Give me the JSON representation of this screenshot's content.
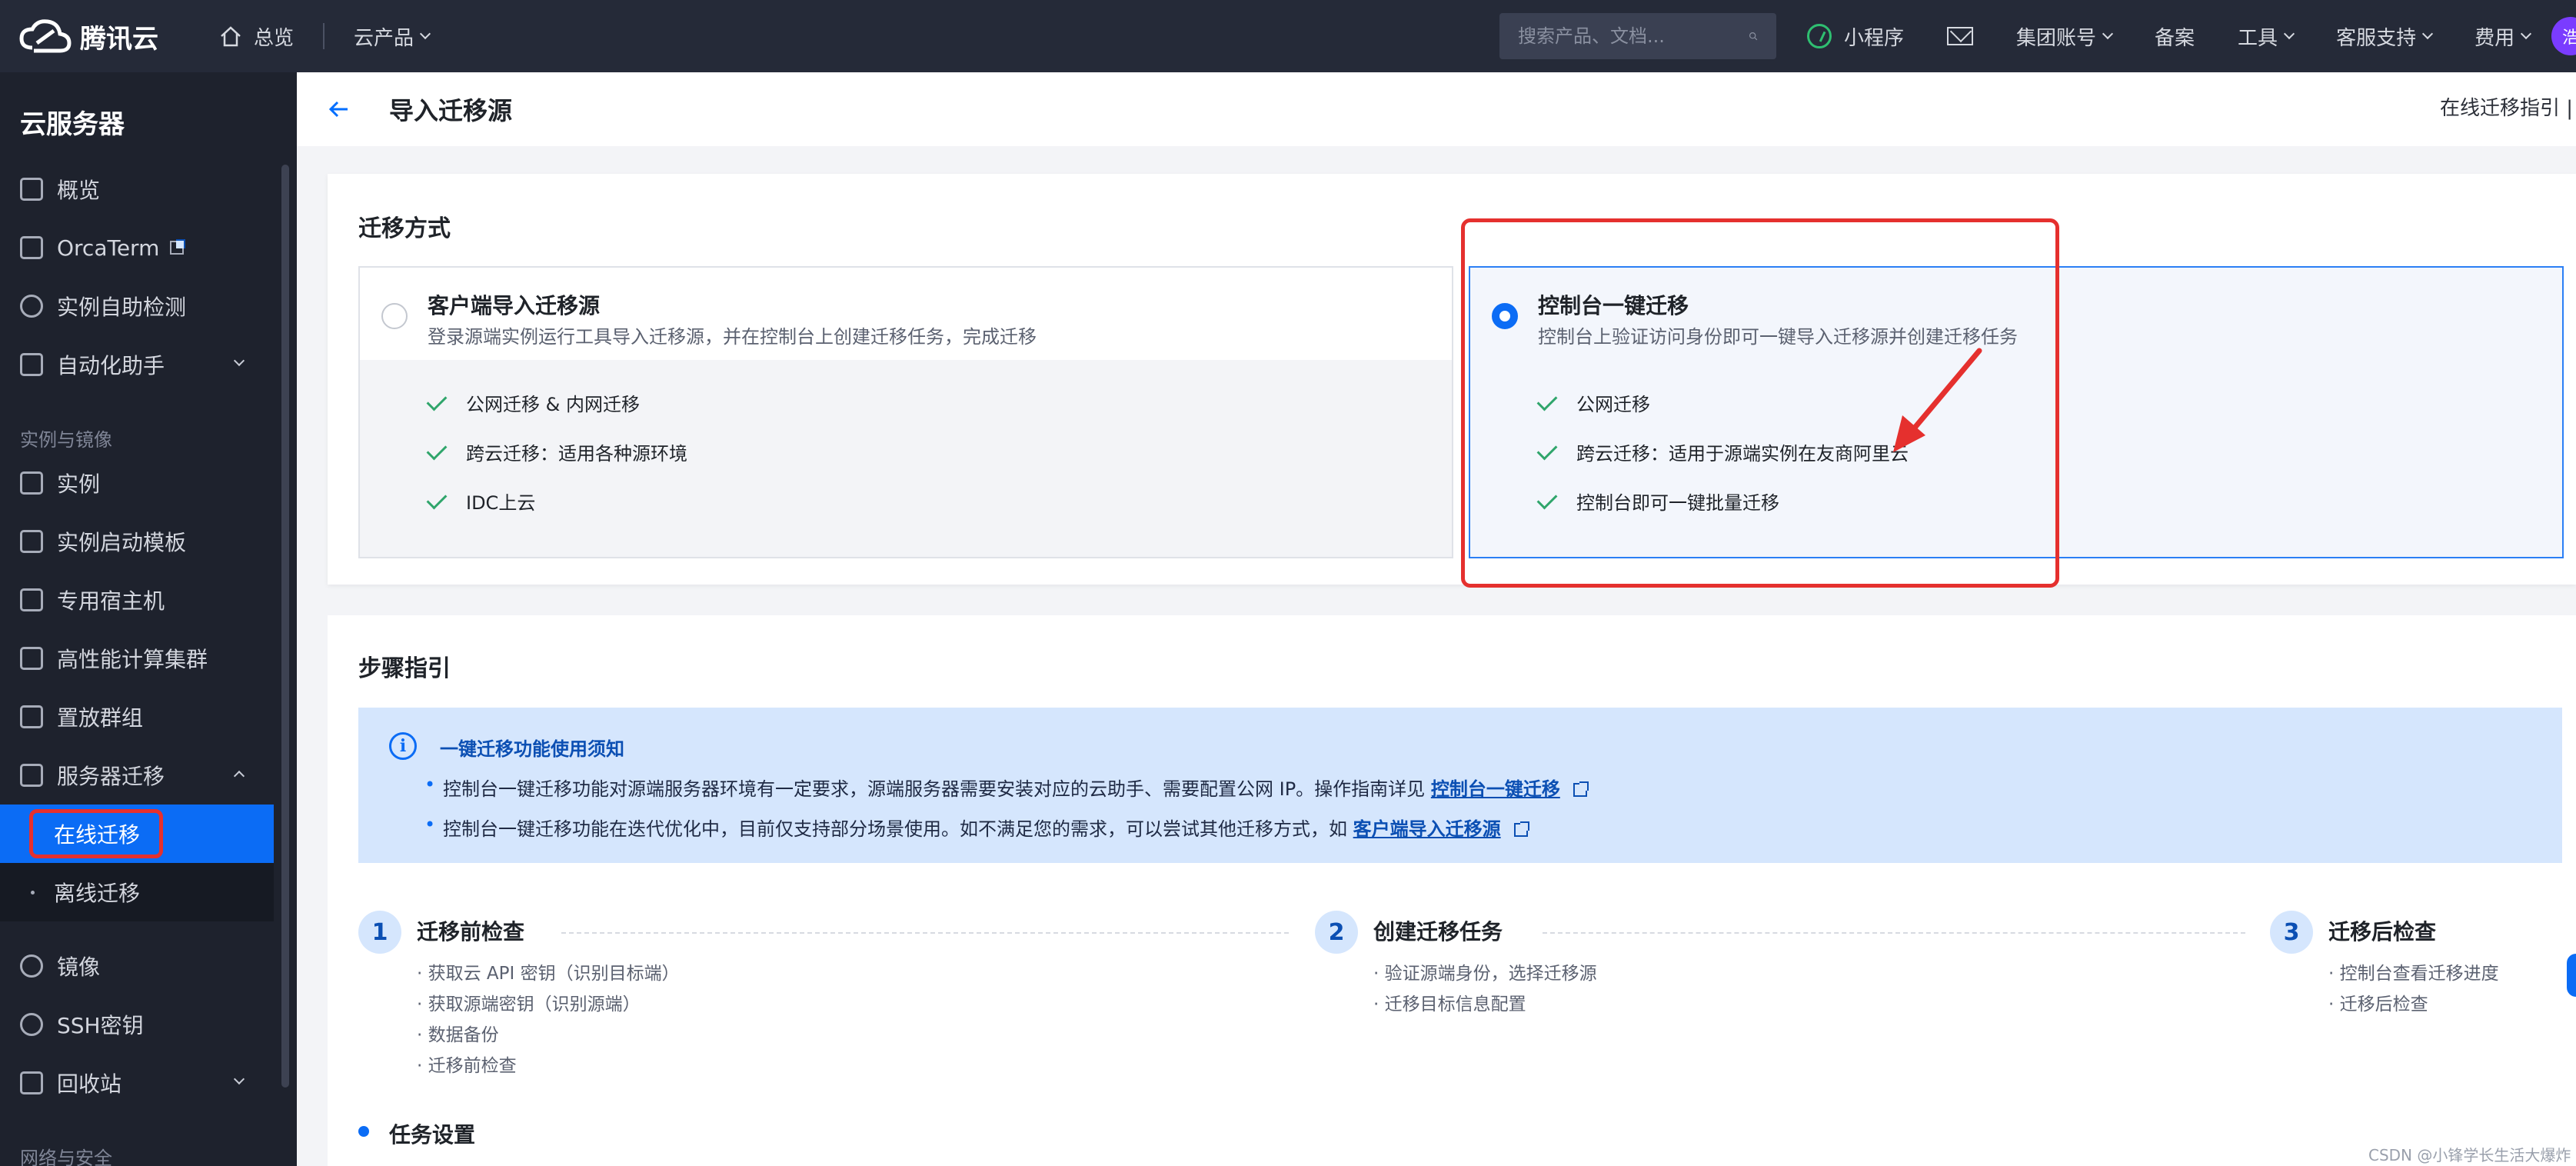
{
  "topbar": {
    "brand": "腾讯云",
    "home": "总览",
    "products": "云产品",
    "search_placeholder": "搜索产品、文档...",
    "items": [
      "小程序",
      "集团账号",
      "备案",
      "工具",
      "客服支持",
      "费用"
    ],
    "avatar": "浩"
  },
  "sidebar": {
    "title": "云服务器",
    "items": {
      "overview": "概览",
      "orcaterm": "OrcaTerm",
      "selfcheck": "实例自助检测",
      "automation": "自动化助手",
      "group1": "实例与镜像",
      "instances": "实例",
      "templates": "实例启动模板",
      "dedicated": "专用宿主机",
      "hpc": "高性能计算集群",
      "placement": "置放群组",
      "migration": "服务器迁移",
      "online": "在线迁移",
      "offline": "离线迁移",
      "images": "镜像",
      "ssh": "SSH密钥",
      "recycle": "回收站",
      "group2": "网络与安全"
    }
  },
  "header": {
    "title": "导入迁移源",
    "guide": "在线迁移指引 |"
  },
  "migration_method": {
    "section_title": "迁移方式",
    "options": [
      {
        "title": "客户端导入迁移源",
        "desc": "登录源端实例运行工具导入迁移源，并在控制台上创建迁移任务，完成迁移",
        "features": [
          "公网迁移 & 内网迁移",
          "跨云迁移：适用各种源环境",
          "IDC上云"
        ],
        "selected": false
      },
      {
        "title": "控制台一键迁移",
        "desc": "控制台上验证访问身份即可一键导入迁移源并创建迁移任务",
        "features": [
          "公网迁移",
          "跨云迁移：适用于源端实例在友商阿里云",
          "控制台即可一键批量迁移"
        ],
        "selected": true
      }
    ]
  },
  "steps_guide": {
    "section_title": "步骤指引",
    "notice": {
      "title": "一键迁移功能使用须知",
      "line1": "控制台一键迁移功能对源端服务器环境有一定要求，源端服务器需要安装对应的云助手、需要配置公网 IP。操作指南详见",
      "line1_link": "控制台一键迁移",
      "line2": "控制台一键迁移功能在迭代优化中，目前仅支持部分场景使用。如不满足您的需求，可以尝试其他迁移方式，如",
      "line2_link": "客户端导入迁移源"
    },
    "steps": [
      {
        "num": "1",
        "title": "迁移前检查",
        "items": [
          "· 获取云 API 密钥（识别目标端）",
          "· 获取源端密钥（识别源端）",
          "· 数据备份",
          "· 迁移前检查"
        ]
      },
      {
        "num": "2",
        "title": "创建迁移任务",
        "items": [
          "· 验证源端身份，选择迁移源",
          "· 迁移目标信息配置"
        ]
      },
      {
        "num": "3",
        "title": "迁移后检查",
        "items": [
          "· 控制台查看迁移进度",
          "· 迁移后检查"
        ]
      }
    ],
    "task_settings": "任务设置"
  },
  "watermark": "CSDN @小锋学长生活大爆炸",
  "colors": {
    "accent": "#0b6cf5",
    "annotation": "#e5302e",
    "topbar": "#252a38",
    "sidebar": "#1e222d"
  }
}
